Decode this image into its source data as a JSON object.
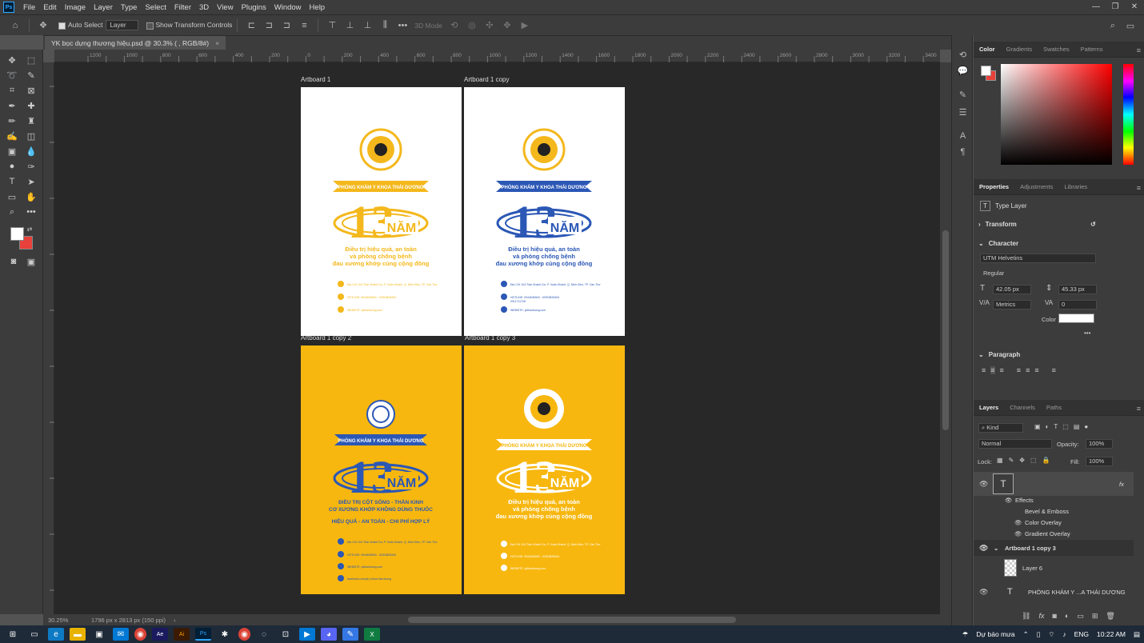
{
  "app": {
    "logo": "Ps"
  },
  "menu": [
    "File",
    "Edit",
    "Image",
    "Layer",
    "Type",
    "Select",
    "Filter",
    "3D",
    "View",
    "Plugins",
    "Window",
    "Help"
  ],
  "window_controls": [
    "—",
    "❐",
    "✕"
  ],
  "options": {
    "auto_select_label": "Auto Select",
    "layer_select": "Layer",
    "show_transform_label": "Show Transform Controls",
    "mode_3d": "3D Mode",
    "more": "•••"
  },
  "document": {
    "tab_title": "YK bọc dựng thương hiệu.psd @ 30.3% (  , RGB/8#)",
    "tab_close": "×"
  },
  "ruler_h": [
    "1200",
    "1100",
    "1000",
    "900",
    "800",
    "700",
    "600",
    "500",
    "400",
    "300",
    "200",
    "100",
    "0",
    "100",
    "200",
    "300",
    "400",
    "500",
    "600",
    "700",
    "800",
    "900",
    "1000",
    "1100",
    "1200",
    "1300",
    "1400",
    "1500",
    "1600",
    "1700",
    "1800",
    "1900",
    "2000",
    "2100",
    "2200",
    "2300",
    "2400",
    "2500",
    "2600",
    "2700",
    "2800",
    "2900",
    "3000",
    "3100",
    "3200",
    "3300",
    "3400"
  ],
  "artboards": [
    {
      "label": "Artboard 1"
    },
    {
      "label": "Artboard 1 copy"
    },
    {
      "label": "Artboard 1 copy 2"
    },
    {
      "label": "Artboard 1 copy 3"
    }
  ],
  "poster": {
    "banner": "PHÒNG KHÁM Y KHOA THÁI DƯƠNG",
    "big_number": "13",
    "nam": "NĂM",
    "line1": "Điều trị hiệu quả, an toàn",
    "line2": "và phòng chống bệnh",
    "line3": "đau xương khớp cùng cộng đồng",
    "alt_line1": "ĐIỀU TRỊ CỘT SỐNG - THẦN KINH",
    "alt_line2": "CƠ XƯƠNG KHỚP KHÔNG DÙNG THUỐC",
    "alt_line3": "HIỆU QUẢ - AN TOÀN - CHI PHÍ HỢP LÝ",
    "addr": "Địa Chỉ: 104 Trần Khánh Dư, P. Xuân Khánh, Q. Ninh Kiều, TP. Cần Thơ",
    "hotline": "HOTLINE: 0944646949 - 02923828494",
    "hotline2": "0911711728",
    "website": "WEBSITE: ykthaiduong.com",
    "facebook": "facebook.com/pk y khoa thai duong"
  },
  "status": {
    "zoom": "30.25%",
    "doc_size": "1796 px x 2813 px (150 ppi)"
  },
  "color_panel": {
    "tabs": [
      "Color",
      "Gradients",
      "Swatches",
      "Patterns"
    ],
    "fg": "#ffffff",
    "bg": "#e8403a"
  },
  "properties": {
    "tabs": [
      "Properties",
      "Adjustments",
      "Libraries"
    ],
    "layer_kind": "Type Layer",
    "transform_label": "Transform",
    "character_label": "Character",
    "font_family": "UTM Helvetins",
    "font_style": "Regular",
    "font_size": "42.05 px",
    "leading": "45.33 px",
    "kerning": "Metrics",
    "tracking": "0",
    "color_label": "Color",
    "text_color": "#ffffff",
    "paragraph_label": "Paragraph"
  },
  "layers": {
    "tabs": [
      "Layers",
      "Channels",
      "Paths"
    ],
    "filter_kind": "Kind",
    "blend_mode": "Normal",
    "opacity_label": "Opacity:",
    "opacity": "100%",
    "lock_label": "Lock:",
    "fill_label": "Fill:",
    "fill": "100%",
    "effects_label": "Effects",
    "effects": [
      "Bevel & Emboss",
      "Color Overlay",
      "Gradient Overlay"
    ],
    "group_name": "Artboard 1 copy 3",
    "layer6": "Layer 6",
    "text_layer": "PHÒNG KHÁM Y ...A THÁI DƯƠNG"
  },
  "taskbar": {
    "weather": "Dự báo mưa",
    "lang": "ENG",
    "time": "10:22 AM"
  }
}
